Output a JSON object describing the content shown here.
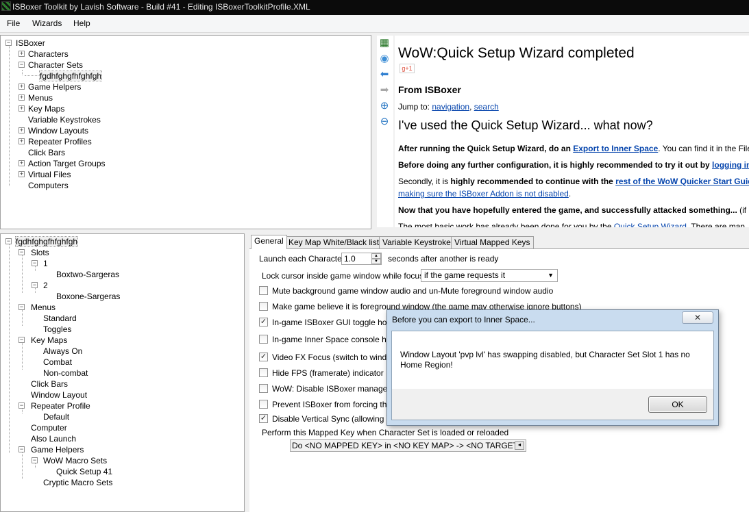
{
  "window": {
    "title": "ISBoxer Toolkit by Lavish Software - Build #41 - Editing ISBoxerToolkitProfile.XML"
  },
  "menu": [
    "File",
    "Wizards",
    "Help"
  ],
  "top_tree": {
    "root": "ISBoxer",
    "items": [
      "Characters",
      "Character Sets",
      "fgdhfghgfhfghfgh",
      "Game Helpers",
      "Menus",
      "Key Maps",
      "Variable Keystrokes",
      "Window Layouts",
      "Repeater Profiles",
      "Click Bars",
      "Action Target Groups",
      "Virtual Files",
      "Computers"
    ]
  },
  "bottom_tree": {
    "root": "fgdhfghgfhfghfgh",
    "items": [
      "Slots",
      "1",
      "Boxtwo-Sargeras",
      "2",
      "Boxone-Sargeras",
      "Menus",
      "Standard",
      "Toggles",
      "Key Maps",
      "Always On",
      "Combat",
      "Non-combat",
      "Click Bars",
      "Window Layout",
      "Repeater Profile",
      "Default",
      "Computer",
      "Also Launch",
      "Game Helpers",
      "WoW Macro Sets",
      "Quick Setup 41",
      "Cryptic Macro Sets"
    ]
  },
  "wiki": {
    "title": "WoW:Quick Setup Wizard completed",
    "gplus": "g+1",
    "from": "From ISBoxer",
    "jump_prefix": "Jump to: ",
    "jump_nav": "navigation",
    "jump_sep": ", ",
    "jump_search": "search",
    "heading": "I've used the Quick Setup Wizard... what now?",
    "p1_bold": "After running the Quick Setup Wizard, do an ",
    "p1_link": "Export to Inner Space",
    "p1_rest": ". You can find it in the File",
    "p2_bold": "Before doing any further configuration, it is highly recommended to try it out by ",
    "p2_link": "logging into",
    "p3_a": "Secondly, it is ",
    "p3_bold": "highly recommended to continue with the ",
    "p3_link": "rest of the WoW Quicker Start Guid",
    "p3_link2": "making sure the ISBoxer Addon is not disabled",
    "p3_end": ".",
    "p4_bold": "Now that you have hopefully entered the game, and successfully attacked something...",
    "p4_rest": " (if no",
    "p5_a": "The most basic work has already been done for you by the ",
    "p5_link": "Quick Setup Wizard",
    "p5_rest": ". There are man"
  },
  "tabs": [
    "General",
    "Key Map White/Black lists",
    "Variable Keystrokes",
    "Virtual Mapped Keys"
  ],
  "general": {
    "launch_label": "Launch each Character",
    "launch_value": "1.0",
    "launch_suffix": "seconds after another is ready",
    "lock_label": "Lock cursor inside game window while focused",
    "lock_value": "if the game requests it",
    "options": [
      {
        "label": "Mute background game window audio and un-Mute foreground window audio",
        "checked": false
      },
      {
        "label": "Make game believe it is foreground window (the game may otherwise ignore buttons)",
        "checked": false
      },
      {
        "label": "In-game ISBoxer GUI toggle hotkey",
        "checked": true
      },
      {
        "label": "In-game Inner Space console hotke",
        "checked": false
      },
      {
        "label": "Video FX Focus (switch to window)",
        "checked": true
      },
      {
        "label": "Hide FPS (framerate) indicator",
        "checked": false
      },
      {
        "label": "WoW: Disable ISBoxer manageme",
        "checked": false
      },
      {
        "label": "Prevent ISBoxer from forcing the ga",
        "checked": false
      },
      {
        "label": "Disable Vertical Sync (allowing V-S",
        "checked": true
      }
    ],
    "mapped_key_label": "Perform this Mapped Key when Character Set is loaded or reloaded",
    "mapped_key_value": "Do <NO MAPPED KEY> in <NO KEY MAP> -> <NO TARGET>"
  },
  "dialog": {
    "title": "Before you can export to Inner Space...",
    "close": "✕",
    "message": "Window Layout 'pvp lvl' has swapping disabled, but Character Set Slot 1 has no Home Region!",
    "ok": "OK"
  }
}
